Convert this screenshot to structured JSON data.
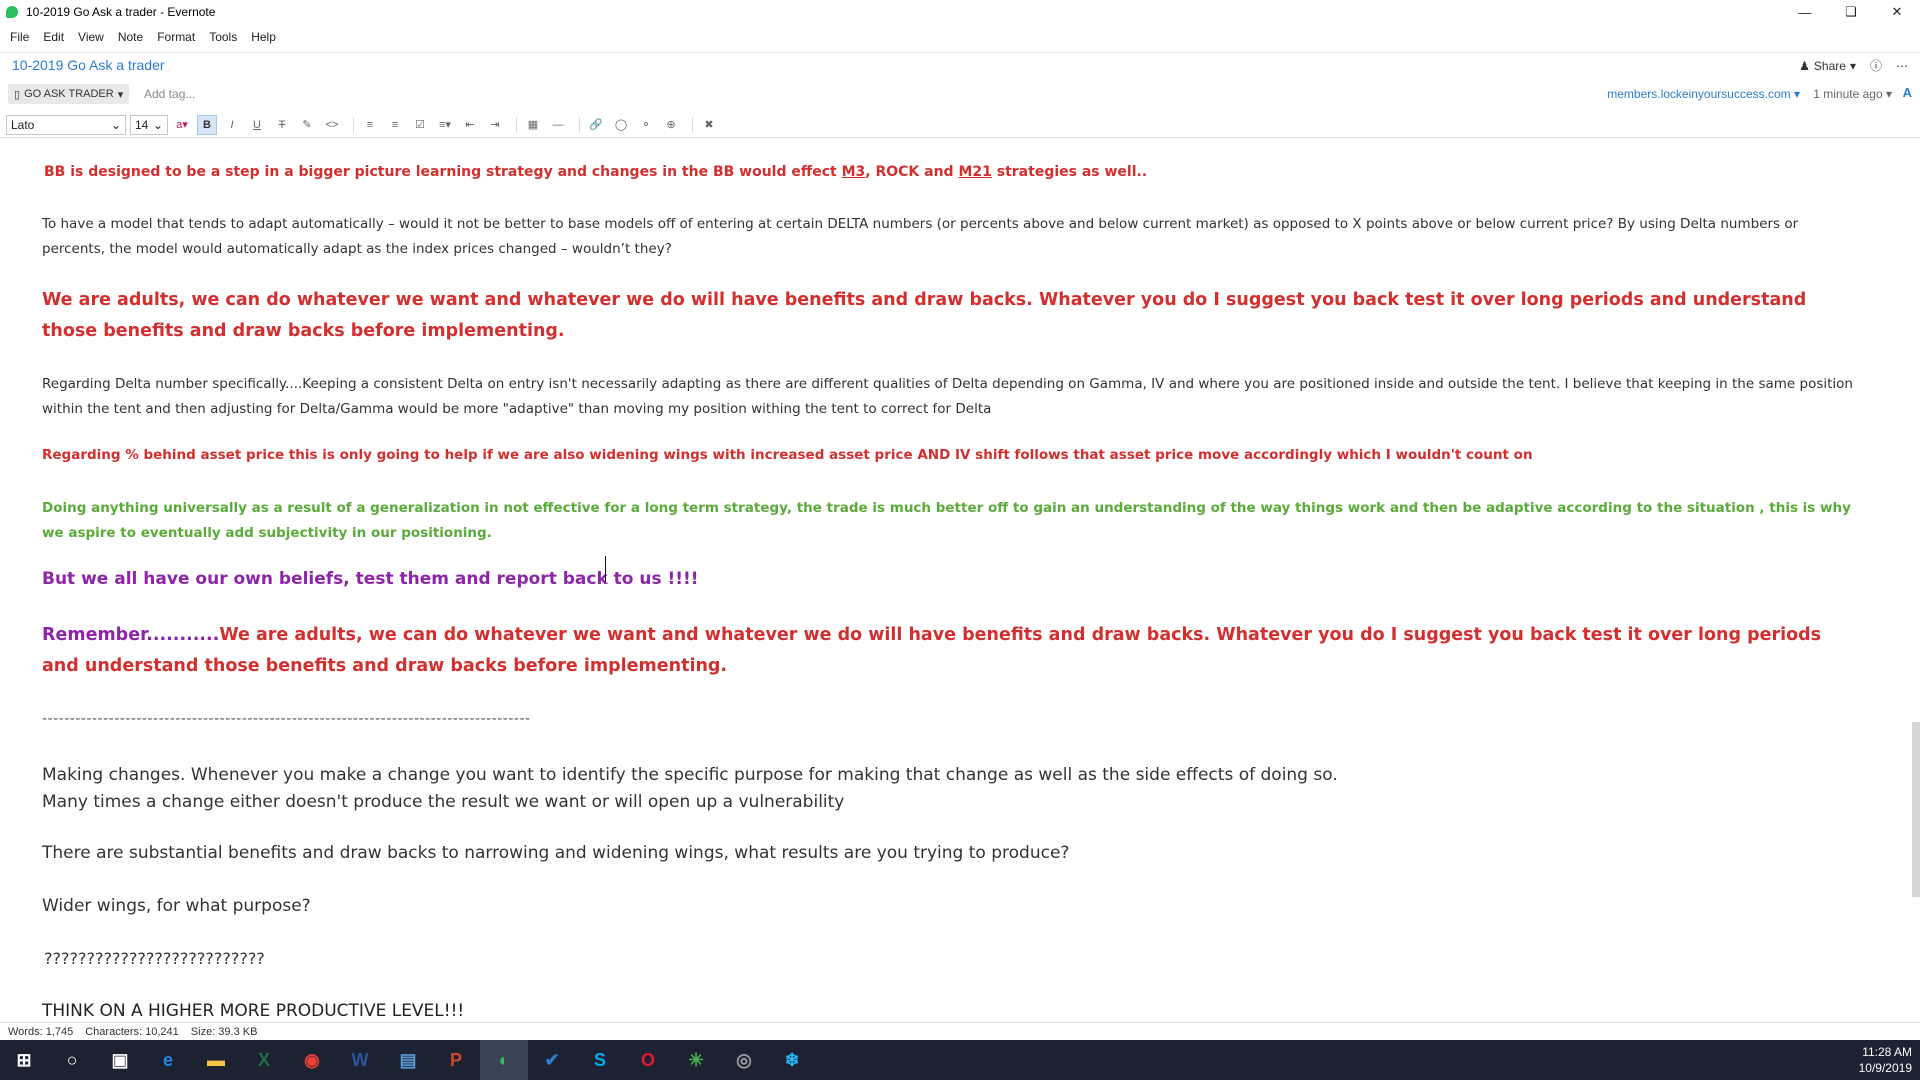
{
  "window": {
    "title": "10-2019 Go Ask a trader - Evernote"
  },
  "menu": [
    "File",
    "Edit",
    "View",
    "Note",
    "Format",
    "Tools",
    "Help"
  ],
  "note": {
    "title": "10-2019 Go Ask a trader",
    "share_label": "Share",
    "notebook": "GO ASK TRADER",
    "add_tag_placeholder": "Add tag...",
    "url": "members.lockeinyoursuccess.com",
    "updated": "1 minute ago"
  },
  "toolbar": {
    "font": "Lato",
    "size": "14"
  },
  "content": {
    "p1_a": "BB is designed to be a step in  a bigger picture learning strategy and changes in the BB would  effect ",
    "p1_m3": "M3",
    "p1_b": ", ROCK and ",
    "p1_m21": "M21",
    "p1_c": " strategies as well..",
    "p2": "To have a model that tends to adapt automatically – would it not be better to base models off of entering at certain DELTA numbers (or percents above and below current market) as opposed to X points above or below current price?  By using Delta numbers or percents, the model would automatically adapt as the index prices changed – wouldn’t they?",
    "p3": "We are adults, we can do whatever we want and whatever we do will have benefits and draw backs. Whatever you do I suggest  you back test it over long periods and understand those benefits and draw backs before implementing.",
    "p4": "Regarding Delta number specifically....Keeping a consistent Delta on entry isn't necessarily adapting as there are different qualities of Delta  depending on Gamma, IV and where you are positioned inside and outside the tent. I believe that keeping in the same position within the tent and then adjusting for Delta/Gamma would be more \"adaptive\" than moving my position withing the tent to correct for Delta",
    "p5": "Regarding % behind asset price this is only going to help if we are also widening wings with increased asset price AND IV shift follows that asset price move accordingly which I wouldn't count on",
    "p6": "Doing anything universally as a result of a generalization in not effective for a long term strategy, the trade is much better off to gain an understanding of the way things work and then be adaptive according to the situation , this is why we aspire to  eventually add subjectivity in our positioning.",
    "p7": "But we all have our own beliefs, test them and report back to us !!!!",
    "p8_rem": "Remember...........",
    "p8": "We are adults, we can do whatever we want and whatever we do will have benefits and draw backs. Whatever you do I suggest  you back test it over long periods and understand those benefits and draw backs before implementing.",
    "p9": "----------------------------------------------------------------------------------------",
    "p10_a": "Making changes. Whenever you make a  change you want to identify the specific purpose for making that change as well as the side effects of doing so.",
    "p10_b": "Many times a change either doesn't produce the result we want or will open up a vulnerability",
    "p11": "There are substantial benefits and draw backs to narrowing and widening wings, what results are you trying to produce?",
    "p12": "Wider wings, for what purpose?",
    "p13": "??????????????????????????",
    "p14": "THINK ON A HIGHER MORE PRODUCTIVE LEVEL!!!"
  },
  "status": {
    "words": "Words: 1,745",
    "characters": "Characters: 10,241",
    "size": "Size: 39.3 KB"
  },
  "taskbar": {
    "apps": [
      {
        "name": "windows-start",
        "glyph": "⊞",
        "color": "#ffffff"
      },
      {
        "name": "search",
        "glyph": "○",
        "color": "#ffffff"
      },
      {
        "name": "task-view",
        "glyph": "▣",
        "color": "#ffffff"
      },
      {
        "name": "edge",
        "glyph": "e",
        "color": "#1e88e5"
      },
      {
        "name": "file-explorer",
        "glyph": "▬",
        "color": "#f6c343"
      },
      {
        "name": "excel",
        "glyph": "X",
        "color": "#1e7145"
      },
      {
        "name": "chrome",
        "glyph": "◉",
        "color": "#ea4335"
      },
      {
        "name": "word",
        "glyph": "W",
        "color": "#2b579a"
      },
      {
        "name": "notebook-app",
        "glyph": "▤",
        "color": "#5b9bd5"
      },
      {
        "name": "powerpoint",
        "glyph": "P",
        "color": "#d24726"
      },
      {
        "name": "evernote",
        "glyph": "◐",
        "color": "#2dbe60"
      },
      {
        "name": "todo",
        "glyph": "✔",
        "color": "#2b7cd3"
      },
      {
        "name": "skype",
        "glyph": "S",
        "color": "#00aff0"
      },
      {
        "name": "opera",
        "glyph": "O",
        "color": "#e2192c"
      },
      {
        "name": "trading-app",
        "glyph": "✳",
        "color": "#4caf50"
      },
      {
        "name": "camera-app",
        "glyph": "◎",
        "color": "#9e9e9e"
      },
      {
        "name": "snowflake-app",
        "glyph": "❄",
        "color": "#29b6f6"
      }
    ],
    "time": "11:28 AM",
    "date": "10/9/2019"
  }
}
